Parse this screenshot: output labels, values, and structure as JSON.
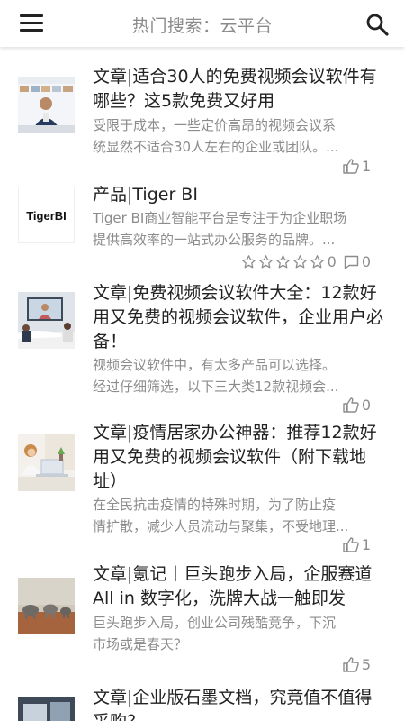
{
  "header": {
    "search_hint": "热门搜索：云平台",
    "menu_icon": "hamburger-menu-icon",
    "search_icon": "magnifier-icon"
  },
  "items": [
    {
      "title": "文章|适合30人的免费视频会议软件有哪些？这5款免费又好用",
      "desc_line1": "受限于成本，一些定价高昂的视频会议系",
      "desc_line2": "统显然不适合30人左右的企业或团队。...",
      "likes": "1",
      "thumb": "video-conference-grid-photo"
    },
    {
      "title": "产品|Tiger BI",
      "desc_line1": "Tiger BI商业智能平台是专注于为企业职场",
      "desc_line2": "提供高效率的一站式办公服务的品牌。...",
      "logo_text": "TigerBI",
      "rating": "0",
      "comments": "0",
      "thumb": "tiger-bi-logo"
    },
    {
      "title": "文章|免费视频会议软件大全：12款好用又免费的视频会议软件，企业用户必备！",
      "desc_line1": "视频会议软件中，有太多产品可以选择。",
      "desc_line2": "经过仔细筛选，以下三大类12款视频会...",
      "likes": "0",
      "thumb": "meeting-room-photo"
    },
    {
      "title": "文章|疫情居家办公神器：推荐12款好用又免费的视频会议软件（附下载地址）",
      "desc_line1": "在全民抗击疫情的特殊时期，为了防止疫",
      "desc_line2": "情扩散，减少人员流动与聚集，不受地理...",
      "likes": "1",
      "thumb": "woman-at-laptop-photo"
    },
    {
      "title": "文章|氪记丨巨头跑步入局，企服赛道All in 数字化，洗牌大战一触即发",
      "desc_line1": "巨头跑步入局，创业公司残酷竞争，下沉",
      "desc_line2": "市场或是春天？",
      "likes": "5",
      "thumb": "elephants-savanna-photo"
    },
    {
      "title": "文章|企业版石墨文档，究竟值不值得采购？",
      "thumb": "document-app-photo"
    }
  ],
  "colors": {
    "title": "#222222",
    "secondary": "#8c8c8c",
    "header_hint": "#8a8a8a"
  }
}
